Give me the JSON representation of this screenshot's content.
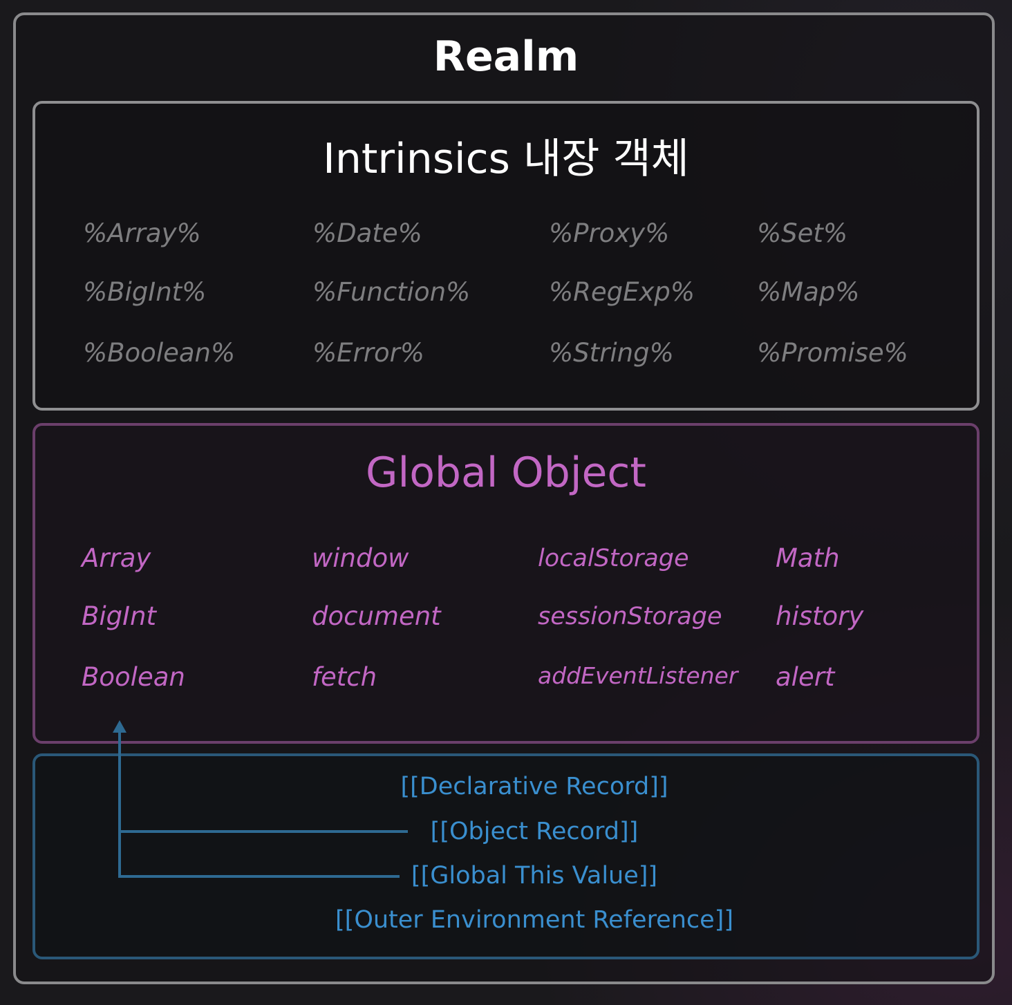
{
  "realm": {
    "title": "Realm"
  },
  "intrinsics": {
    "title": "Intrinsics 내장 객체",
    "columns": [
      [
        "%Array%",
        "%BigInt%",
        "%Boolean%"
      ],
      [
        "%Date%",
        "%Function%",
        "%Error%"
      ],
      [
        "%Proxy%",
        "%RegExp%",
        "%String%"
      ],
      [
        "%Set%",
        "%Map%",
        "%Promise%"
      ]
    ]
  },
  "global_object": {
    "title": "Global Object",
    "columns": [
      [
        "Array",
        "BigInt",
        "Boolean"
      ],
      [
        "window",
        "document",
        "fetch"
      ],
      [
        "localStorage",
        "sessionStorage",
        "addEventListener"
      ],
      [
        "Math",
        "history",
        "alert"
      ]
    ]
  },
  "global_environment": {
    "records": [
      "[[Declarative Record]]",
      "[[Object Record]]",
      "[[Global This Value]]",
      "[[Outer Environment Reference]]"
    ]
  },
  "colors": {
    "realm_border": "#8a8a8c",
    "intrinsics_text": "#7e7e80",
    "global_accent": "#c267c4",
    "environment_accent": "#3a8fcf",
    "arrow": "#2e6a92"
  }
}
